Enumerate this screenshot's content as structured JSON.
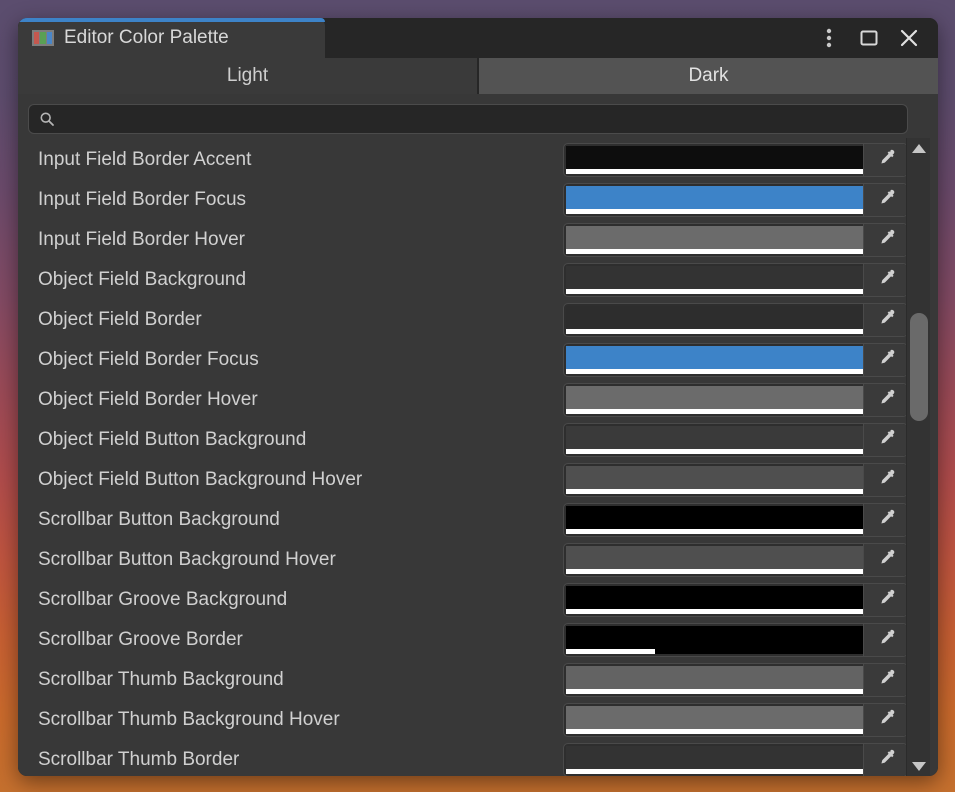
{
  "window": {
    "title": "Editor Color Palette",
    "icon": "color-palette-icon",
    "accent_color": "#3d83c8",
    "controls": {
      "menu_label": "⋮",
      "menu_icon": "more-vertical-icon",
      "maximize_icon": "maximize-icon",
      "close_icon": "close-icon"
    }
  },
  "tabs": {
    "items": [
      {
        "label": "Light",
        "active": false
      },
      {
        "label": "Dark",
        "active": true
      }
    ]
  },
  "search": {
    "value": "",
    "placeholder": "",
    "icon": "search-icon"
  },
  "list": {
    "picker_icon": "eyedropper-icon",
    "rows": [
      {
        "label": "Input Field Border Accent",
        "color": "#0d0d0d",
        "alpha": 100
      },
      {
        "label": "Input Field Border Focus",
        "color": "#3d83c8",
        "alpha": 100
      },
      {
        "label": "Input Field Border Hover",
        "color": "#6b6b6b",
        "alpha": 100
      },
      {
        "label": "Object Field Background",
        "color": "#333333",
        "alpha": 100
      },
      {
        "label": "Object Field Border",
        "color": "#2d2d2d",
        "alpha": 100
      },
      {
        "label": "Object Field Border Focus",
        "color": "#3d83c8",
        "alpha": 100
      },
      {
        "label": "Object Field Border Hover",
        "color": "#6b6b6b",
        "alpha": 100
      },
      {
        "label": "Object Field Button Background",
        "color": "#3a3a3a",
        "alpha": 100
      },
      {
        "label": "Object Field Button Background Hover",
        "color": "#4f4f4f",
        "alpha": 100
      },
      {
        "label": "Scrollbar Button Background",
        "color": "#000000",
        "alpha": 100
      },
      {
        "label": "Scrollbar Button Background Hover",
        "color": "#4f4f4f",
        "alpha": 100
      },
      {
        "label": "Scrollbar Groove Background",
        "color": "#000000",
        "alpha": 100
      },
      {
        "label": "Scrollbar Groove Border",
        "color": "#000000",
        "alpha": 30
      },
      {
        "label": "Scrollbar Thumb Background",
        "color": "#636363",
        "alpha": 100
      },
      {
        "label": "Scrollbar Thumb Background Hover",
        "color": "#6b6b6b",
        "alpha": 100
      },
      {
        "label": "Scrollbar Thumb Border",
        "color": "#333333",
        "alpha": 100
      }
    ]
  },
  "scrollbar": {
    "up_icon": "chevron-up-icon",
    "down_icon": "chevron-down-icon",
    "thumb_top_pct": 26,
    "thumb_height_pct": 18
  }
}
